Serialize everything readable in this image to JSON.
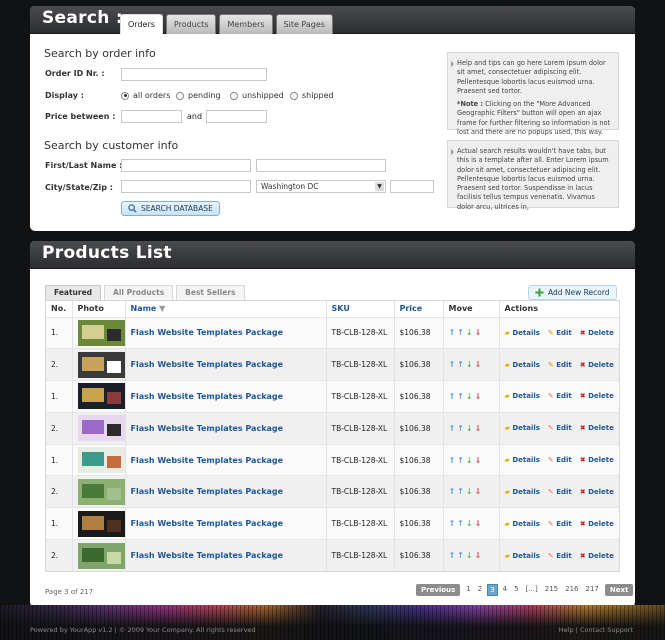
{
  "search": {
    "title": "Search :",
    "tabs": [
      "Orders",
      "Products",
      "Members",
      "Site Pages"
    ],
    "order_section": "Search by order info",
    "order_id_label": "Order ID Nr. :",
    "display_label": "Display :",
    "display_options": [
      "all orders",
      "pending",
      "unshipped",
      "shipped"
    ],
    "display_selected": "all orders",
    "price_label": "Price between :",
    "price_and": "and",
    "customer_section": "Search by customer info",
    "name_label": "First/Last Name :",
    "city_label": "City/State/Zip :",
    "state_value": "Washington DC",
    "search_button": "SEARCH DATABASE",
    "help1_p1": "Help and tips can go here Lorem ipsum dolor sit amet, consectetuer adipiscing elit. Pellentesque lobortis lacus euismod urna. Praesent sed tortor.",
    "help1_note_label": "*Note :",
    "help1_p2": " Clicking on the \"More Advanced Geographic Filters\" button will open an ajax frame for further filtering so information is not lost and there are no popups used, this way.",
    "help2": "Actual search results wouldn't have tabs, but this is a template after all. Enter Lorem ipsum dolor sit amet, consectetuer adipiscing elit. Pellentesque lobortis lacus euismod urna. Praesent sed tortor. Suspendisse in lacus facilisis tellus tempus venenatis. Vivamus dolor arcu, ultrices in,"
  },
  "products": {
    "title": "Products List",
    "tabs": [
      "Featured",
      "All Products",
      "Best Sellers"
    ],
    "add_button": "Add New Record",
    "columns": [
      "No.",
      "Photo",
      "Name",
      "SKU",
      "Price",
      "Move",
      "Actions"
    ],
    "action_labels": {
      "details": "Details",
      "edit": "Edit",
      "delete": "Delete"
    },
    "rows": [
      {
        "no": "1.",
        "name": "Flash Website Templates Package",
        "sku": "TB-CLB-128-XL",
        "price": "$106.38"
      },
      {
        "no": "2.",
        "name": "Flash Website Templates Package",
        "sku": "TB-CLB-128-XL",
        "price": "$106.38"
      },
      {
        "no": "1.",
        "name": "Flash Website Templates Package",
        "sku": "TB-CLB-128-XL",
        "price": "$106.38"
      },
      {
        "no": "2.",
        "name": "Flash Website Templates Package",
        "sku": "TB-CLB-128-XL",
        "price": "$106.38"
      },
      {
        "no": "1.",
        "name": "Flash Website Templates Package",
        "sku": "TB-CLB-128-XL",
        "price": "$106.38"
      },
      {
        "no": "2.",
        "name": "Flash Website Templates Package",
        "sku": "TB-CLB-128-XL",
        "price": "$106.38"
      },
      {
        "no": "1.",
        "name": "Flash Website Templates Package",
        "sku": "TB-CLB-128-XL",
        "price": "$106.38"
      },
      {
        "no": "2.",
        "name": "Flash Website Templates Package",
        "sku": "TB-CLB-128-XL",
        "price": "$106.38"
      }
    ],
    "page_info": "Page 3 of 217",
    "pagination": {
      "prev": "Previous",
      "next": "Next",
      "pages": [
        "1",
        "2",
        "3",
        "4",
        "5",
        "[...]",
        "215",
        "216",
        "217"
      ],
      "current": "3"
    }
  },
  "footer": {
    "left": "Powered by YourApp v1.2 | © 2009 Your Company. All rights reserved",
    "right": "Help | Contact Support"
  },
  "colors": {
    "accent": "#1d5796",
    "header": "#3a3b3e",
    "background": "#111214"
  }
}
